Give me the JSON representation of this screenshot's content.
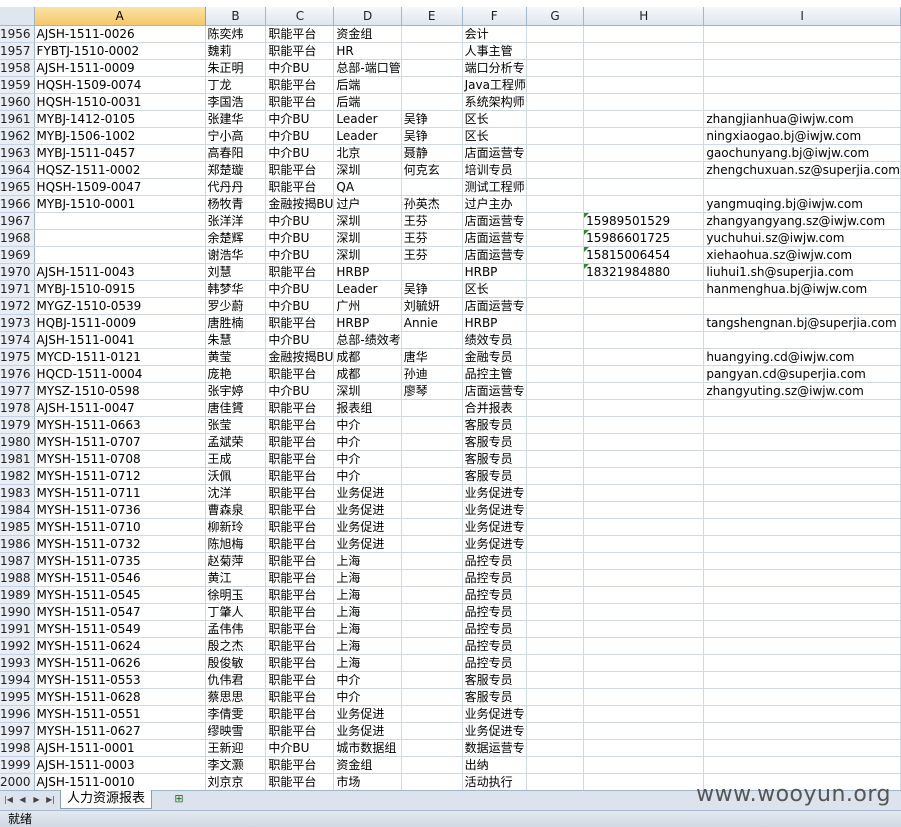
{
  "columns": [
    "A",
    "B",
    "C",
    "D",
    "E",
    "F",
    "G",
    "H",
    "I"
  ],
  "rows": [
    {
      "n": "1956",
      "c": [
        "AJSH-1511-0026",
        "陈奕炜",
        "职能平台",
        "资金组",
        "",
        "会计",
        "",
        "",
        ""
      ]
    },
    {
      "n": "1957",
      "c": [
        "FYBTJ-1510-0002",
        "魏莉",
        "职能平台",
        "HR",
        "",
        "人事主管",
        "",
        "",
        ""
      ]
    },
    {
      "n": "1958",
      "c": [
        "AJSH-1511-0009",
        "朱正明",
        "中介BU",
        "总部-端口管",
        "",
        "端口分析专",
        "",
        "",
        ""
      ]
    },
    {
      "n": "1959",
      "c": [
        "HQSH-1509-0074",
        "丁龙",
        "职能平台",
        "后端",
        "",
        "Java工程师",
        "",
        "",
        ""
      ]
    },
    {
      "n": "1960",
      "c": [
        "HQSH-1510-0031",
        "李国浩",
        "职能平台",
        "后端",
        "",
        "系统架构师",
        "",
        "",
        ""
      ]
    },
    {
      "n": "1961",
      "c": [
        "MYBJ-1412-0105",
        "张建华",
        "中介BU",
        "Leader",
        "吴铮",
        "区长",
        "",
        "",
        "zhangjianhua@iwjw.com"
      ]
    },
    {
      "n": "1962",
      "c": [
        "MYBJ-1506-1002",
        "宁小高",
        "中介BU",
        "Leader",
        "吴铮",
        "区长",
        "",
        "",
        "ningxiaogao.bj@iwjw.com"
      ]
    },
    {
      "n": "1963",
      "c": [
        "MYBJ-1511-0457",
        "高春阳",
        "中介BU",
        "北京",
        "聂静",
        "店面运营专",
        "",
        "",
        "gaochunyang.bj@iwjw.com"
      ]
    },
    {
      "n": "1964",
      "c": [
        "HQSZ-1511-0002",
        "郑楚璇",
        "职能平台",
        "深圳",
        "何克玄",
        "培训专员",
        "",
        "",
        "zhengchuxuan.sz@superjia.com"
      ]
    },
    {
      "n": "1965",
      "c": [
        "HQSH-1509-0047",
        "代丹丹",
        "职能平台",
        "QA",
        "",
        "测试工程师",
        "",
        "",
        ""
      ]
    },
    {
      "n": "1966",
      "c": [
        "MYBJ-1510-0001",
        "杨牧青",
        "金融按揭BU",
        "过户",
        "孙英杰",
        "过户主办",
        "",
        "",
        "yangmuqing.bj@iwjw.com"
      ]
    },
    {
      "n": "1967",
      "c": [
        "",
        "张洋洋",
        "中介BU",
        "深圳",
        "王芬",
        "店面运营专",
        "",
        "15989501529",
        "zhangyangyang.sz@iwjw.com"
      ]
    },
    {
      "n": "1968",
      "c": [
        "",
        "余楚辉",
        "中介BU",
        "深圳",
        "王芬",
        "店面运营专",
        "",
        "15986601725",
        "yuchuhui.sz@iwjw.com"
      ]
    },
    {
      "n": "1969",
      "c": [
        "",
        "谢浩华",
        "中介BU",
        "深圳",
        "王芬",
        "店面运营专",
        "",
        "15815006454",
        "xiehaohua.sz@iwjw.com"
      ]
    },
    {
      "n": "1970",
      "c": [
        "AJSH-1511-0043",
        "刘慧",
        "职能平台",
        "HRBP",
        "",
        "HRBP",
        "",
        "18321984880",
        "liuhui1.sh@superjia.com"
      ]
    },
    {
      "n": "1971",
      "c": [
        "MYBJ-1510-0915",
        "韩梦华",
        "中介BU",
        "Leader",
        "吴铮",
        "区长",
        "",
        "",
        "hanmenghua.bj@iwjw.com"
      ]
    },
    {
      "n": "1972",
      "c": [
        "MYGZ-1510-0539",
        "罗少蔚",
        "中介BU",
        "广州",
        "刘毓妍",
        "店面运营专",
        "",
        "",
        ""
      ]
    },
    {
      "n": "1973",
      "c": [
        "HQBJ-1511-0009",
        "唐胜楠",
        "职能平台",
        "HRBP",
        "Annie",
        "HRBP",
        "",
        "",
        "tangshengnan.bj@superjia.com"
      ]
    },
    {
      "n": "1974",
      "c": [
        "AJSH-1511-0041",
        "朱慧",
        "中介BU",
        "总部-绩效考",
        "",
        "绩效专员",
        "",
        "",
        ""
      ]
    },
    {
      "n": "1975",
      "c": [
        "MYCD-1511-0121",
        "黄莹",
        "金融按揭BU",
        "成都",
        "唐华",
        "金融专员",
        "",
        "",
        "huangying.cd@iwjw.com"
      ]
    },
    {
      "n": "1976",
      "c": [
        "HQCD-1511-0004",
        "庞艳",
        "职能平台",
        "成都",
        "孙迪",
        "品控主管",
        "",
        "",
        "pangyan.cd@superjia.com"
      ]
    },
    {
      "n": "1977",
      "c": [
        "MYSZ-1510-0598",
        "张宇婷",
        "中介BU",
        "深圳",
        "廖琴",
        "店面运营专",
        "",
        "",
        "zhangyuting.sz@iwjw.com"
      ]
    },
    {
      "n": "1978",
      "c": [
        "AJSH-1511-0047",
        "唐佳贇",
        "职能平台",
        "报表组",
        "",
        "合并报表",
        "",
        "",
        ""
      ]
    },
    {
      "n": "1979",
      "c": [
        "MYSH-1511-0663",
        "张莹",
        "职能平台",
        "中介",
        "",
        "客服专员",
        "",
        "",
        ""
      ]
    },
    {
      "n": "1980",
      "c": [
        "MYSH-1511-0707",
        "孟斌荣",
        "职能平台",
        "中介",
        "",
        "客服专员",
        "",
        "",
        ""
      ]
    },
    {
      "n": "1981",
      "c": [
        "MYSH-1511-0708",
        "王成",
        "职能平台",
        "中介",
        "",
        "客服专员",
        "",
        "",
        ""
      ]
    },
    {
      "n": "1982",
      "c": [
        "MYSH-1511-0712",
        "沃佩",
        "职能平台",
        "中介",
        "",
        "客服专员",
        "",
        "",
        ""
      ]
    },
    {
      "n": "1983",
      "c": [
        "MYSH-1511-0711",
        "沈洋",
        "职能平台",
        "业务促进",
        "",
        "业务促进专",
        "",
        "",
        ""
      ]
    },
    {
      "n": "1984",
      "c": [
        "MYSH-1511-0736",
        "曹森泉",
        "职能平台",
        "业务促进",
        "",
        "业务促进专",
        "",
        "",
        ""
      ]
    },
    {
      "n": "1985",
      "c": [
        "MYSH-1511-0710",
        "柳新玲",
        "职能平台",
        "业务促进",
        "",
        "业务促进专",
        "",
        "",
        ""
      ]
    },
    {
      "n": "1986",
      "c": [
        "MYSH-1511-0732",
        "陈旭梅",
        "职能平台",
        "业务促进",
        "",
        "业务促进专",
        "",
        "",
        ""
      ]
    },
    {
      "n": "1987",
      "c": [
        "MYSH-1511-0735",
        "赵菊萍",
        "职能平台",
        "上海",
        "",
        "品控专员",
        "",
        "",
        ""
      ]
    },
    {
      "n": "1988",
      "c": [
        "MYSH-1511-0546",
        "黄江",
        "职能平台",
        "上海",
        "",
        "品控专员",
        "",
        "",
        ""
      ]
    },
    {
      "n": "1989",
      "c": [
        "MYSH-1511-0545",
        "徐明玉",
        "职能平台",
        "上海",
        "",
        "品控专员",
        "",
        "",
        ""
      ]
    },
    {
      "n": "1990",
      "c": [
        "MYSH-1511-0547",
        "丁肇人",
        "职能平台",
        "上海",
        "",
        "品控专员",
        "",
        "",
        ""
      ]
    },
    {
      "n": "1991",
      "c": [
        "MYSH-1511-0549",
        "孟伟伟",
        "职能平台",
        "上海",
        "",
        "品控专员",
        "",
        "",
        ""
      ]
    },
    {
      "n": "1992",
      "c": [
        "MYSH-1511-0624",
        "殷之杰",
        "职能平台",
        "上海",
        "",
        "品控专员",
        "",
        "",
        ""
      ]
    },
    {
      "n": "1993",
      "c": [
        "MYSH-1511-0626",
        "殷俊敏",
        "职能平台",
        "上海",
        "",
        "品控专员",
        "",
        "",
        ""
      ]
    },
    {
      "n": "1994",
      "c": [
        "MYSH-1511-0553",
        "仇伟君",
        "职能平台",
        "中介",
        "",
        "客服专员",
        "",
        "",
        ""
      ]
    },
    {
      "n": "1995",
      "c": [
        "MYSH-1511-0628",
        "蔡思思",
        "职能平台",
        "中介",
        "",
        "客服专员",
        "",
        "",
        ""
      ]
    },
    {
      "n": "1996",
      "c": [
        "MYSH-1511-0551",
        "李倩雯",
        "职能平台",
        "业务促进",
        "",
        "业务促进专",
        "",
        "",
        ""
      ]
    },
    {
      "n": "1997",
      "c": [
        "MYSH-1511-0627",
        "缪映雪",
        "职能平台",
        "业务促进",
        "",
        "业务促进专",
        "",
        "",
        ""
      ]
    },
    {
      "n": "1998",
      "c": [
        "AJSH-1511-0001",
        "王新迎",
        "中介BU",
        "城市数据组",
        "",
        "数据运营专",
        "",
        "",
        ""
      ]
    },
    {
      "n": "1999",
      "c": [
        "AJSH-1511-0003",
        "李文灏",
        "职能平台",
        "资金组",
        "",
        "出纳",
        "",
        "",
        ""
      ]
    },
    {
      "n": "2000",
      "c": [
        "AJSH-1511-0010",
        "刘京京",
        "职能平台",
        "市场",
        "",
        "活动执行",
        "",
        "",
        ""
      ]
    }
  ],
  "sheet_tab": "人力资源报表",
  "status": "就绪",
  "watermark": "www.wooyun.org",
  "colors": {
    "header_bg": "#dfe6ef",
    "selected_header": "#f5c869",
    "gridline": "#d0d7e5"
  }
}
